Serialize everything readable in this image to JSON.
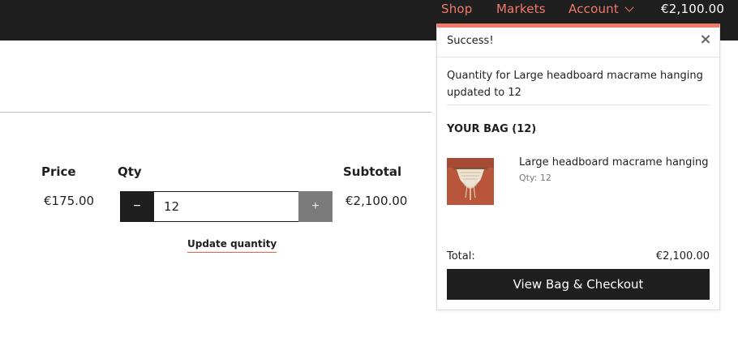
{
  "header": {
    "nav": {
      "shop": "Shop",
      "markets": "Markets",
      "account": "Account",
      "cart_total": "€2,100.00"
    }
  },
  "cart_table": {
    "headers": {
      "price": "Price",
      "qty": "Qty",
      "subtotal": "Subtotal"
    },
    "row": {
      "price": "€175.00",
      "qty_value": "12",
      "decrement": "−",
      "increment": "+",
      "subtotal": "€2,100.00"
    },
    "update_label": "Update quantity"
  },
  "popup": {
    "title": "Success!",
    "close": "×",
    "message": "Quantity for Large headboard macrame hanging updated to 12",
    "bag_heading": "YOUR BAG (12)",
    "item": {
      "name": "Large headboard macrame hanging",
      "qty": "Qty: 12"
    },
    "total_label": "Total:",
    "total_value": "€2,100.00",
    "checkout_label": "View Bag & Checkout"
  },
  "colors": {
    "accent": "#f07a68",
    "dark": "#1f1f1f",
    "muted_button": "#7a7a7a"
  },
  "icons": {
    "account_dropdown": "chevron-down-icon",
    "popup_close": "close-icon",
    "decrement": "minus-icon",
    "increment": "plus-icon"
  }
}
